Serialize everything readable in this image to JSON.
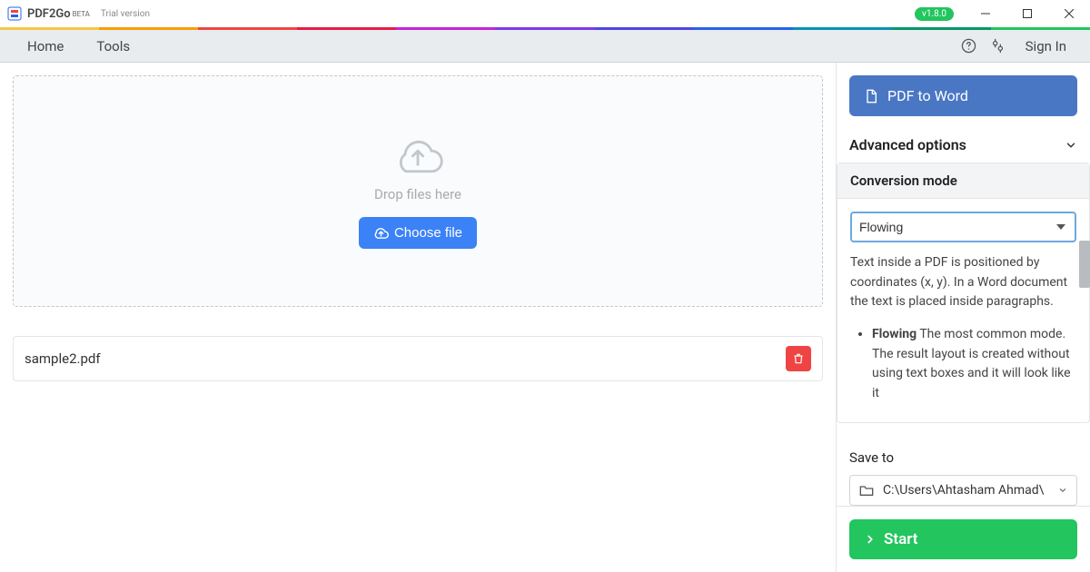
{
  "titlebar": {
    "app_name": "PDF2Go",
    "beta": "BETA",
    "trial": "Trial version",
    "version": "v1.8.0"
  },
  "menubar": {
    "home": "Home",
    "tools": "Tools",
    "signin": "Sign In"
  },
  "dropzone": {
    "text": "Drop files here",
    "choose": "Choose file"
  },
  "file": {
    "name": "sample2.pdf"
  },
  "right": {
    "convert_label": "PDF to Word",
    "advanced": "Advanced options",
    "mode_title": "Conversion mode",
    "mode_value": "Flowing",
    "help_intro": "Text inside a PDF is positioned by coordinates (x, y). In a Word document the text is placed inside paragraphs.",
    "flowing_name": "Flowing",
    "flowing_desc": " The most common mode. The result layout is created without using text boxes and it will look like it",
    "saveto_label": "Save to",
    "saveto_path": "C:\\Users\\Ahtasham Ahmad\\",
    "start": "Start"
  },
  "stripe_colors": [
    "#f6c745",
    "#f59e0b",
    "#ef4444",
    "#e11d48",
    "#c026d3",
    "#7c3aed",
    "#4f46e5",
    "#2563eb",
    "#0891b2",
    "#059669",
    "#22c55e"
  ]
}
